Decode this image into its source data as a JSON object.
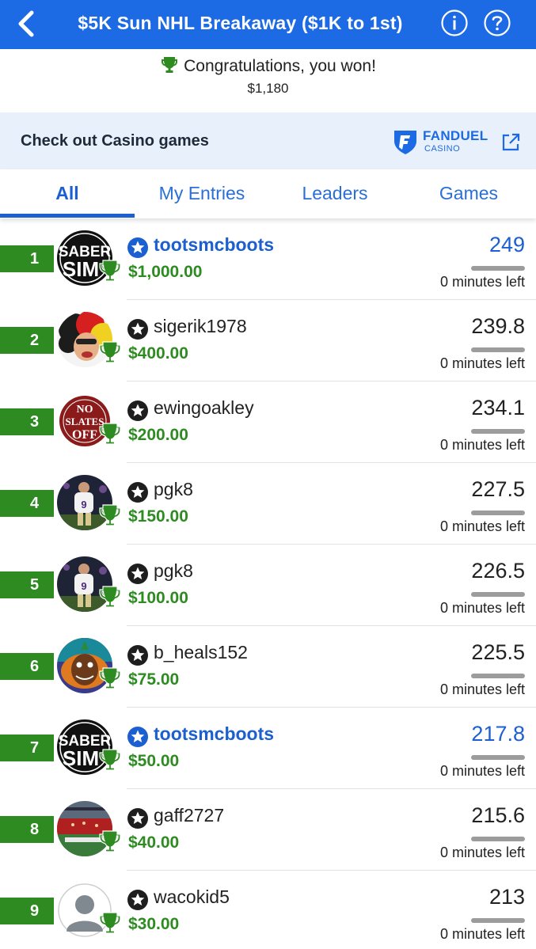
{
  "header": {
    "title": "$5K Sun NHL Breakaway ($1K to 1st)"
  },
  "win": {
    "message": "Congratulations, you won!",
    "amount": "$1,180"
  },
  "promo": {
    "text": "Check out Casino games",
    "brand": "FANDUEL",
    "brand_sub": "CASINO"
  },
  "tabs": [
    {
      "label": "All",
      "active": true
    },
    {
      "label": "My Entries",
      "active": false
    },
    {
      "label": "Leaders",
      "active": false
    },
    {
      "label": "Games",
      "active": false
    }
  ],
  "colors": {
    "brand_blue": "#1c6ae4",
    "prize_green": "#2e8b22",
    "promo_bg": "#e8f0fb"
  },
  "entries": [
    {
      "rank": "1",
      "username": "tootsmcboots",
      "prize": "$1,000.00",
      "score": "249",
      "time_left": "0 minutes left",
      "is_me": true,
      "avatar": "saber-sim-logo"
    },
    {
      "rank": "2",
      "username": "sigerik1978",
      "prize": "$400.00",
      "score": "239.8",
      "time_left": "0 minutes left",
      "is_me": false,
      "avatar": "clown-wig-photo"
    },
    {
      "rank": "3",
      "username": "ewingoakley",
      "prize": "$200.00",
      "score": "234.1",
      "time_left": "0 minutes left",
      "is_me": false,
      "avatar": "no-slates-off-logo"
    },
    {
      "rank": "4",
      "username": "pgk8",
      "prize": "$150.00",
      "score": "227.5",
      "time_left": "0 minutes left",
      "is_me": false,
      "avatar": "football-player-photo"
    },
    {
      "rank": "5",
      "username": "pgk8",
      "prize": "$100.00",
      "score": "226.5",
      "time_left": "0 minutes left",
      "is_me": false,
      "avatar": "football-player-photo"
    },
    {
      "rank": "6",
      "username": "b_heals152",
      "prize": "$75.00",
      "score": "225.5",
      "time_left": "0 minutes left",
      "is_me": false,
      "avatar": "cartoon-character"
    },
    {
      "rank": "7",
      "username": "tootsmcboots",
      "prize": "$50.00",
      "score": "217.8",
      "time_left": "0 minutes left",
      "is_me": true,
      "avatar": "saber-sim-logo"
    },
    {
      "rank": "8",
      "username": "gaff2727",
      "prize": "$40.00",
      "score": "215.6",
      "time_left": "0 minutes left",
      "is_me": false,
      "avatar": "stadium-photo"
    },
    {
      "rank": "9",
      "username": "wacokid5",
      "prize": "$30.00",
      "score": "213",
      "time_left": "0 minutes left",
      "is_me": false,
      "avatar": "default-user-silhouette"
    }
  ]
}
